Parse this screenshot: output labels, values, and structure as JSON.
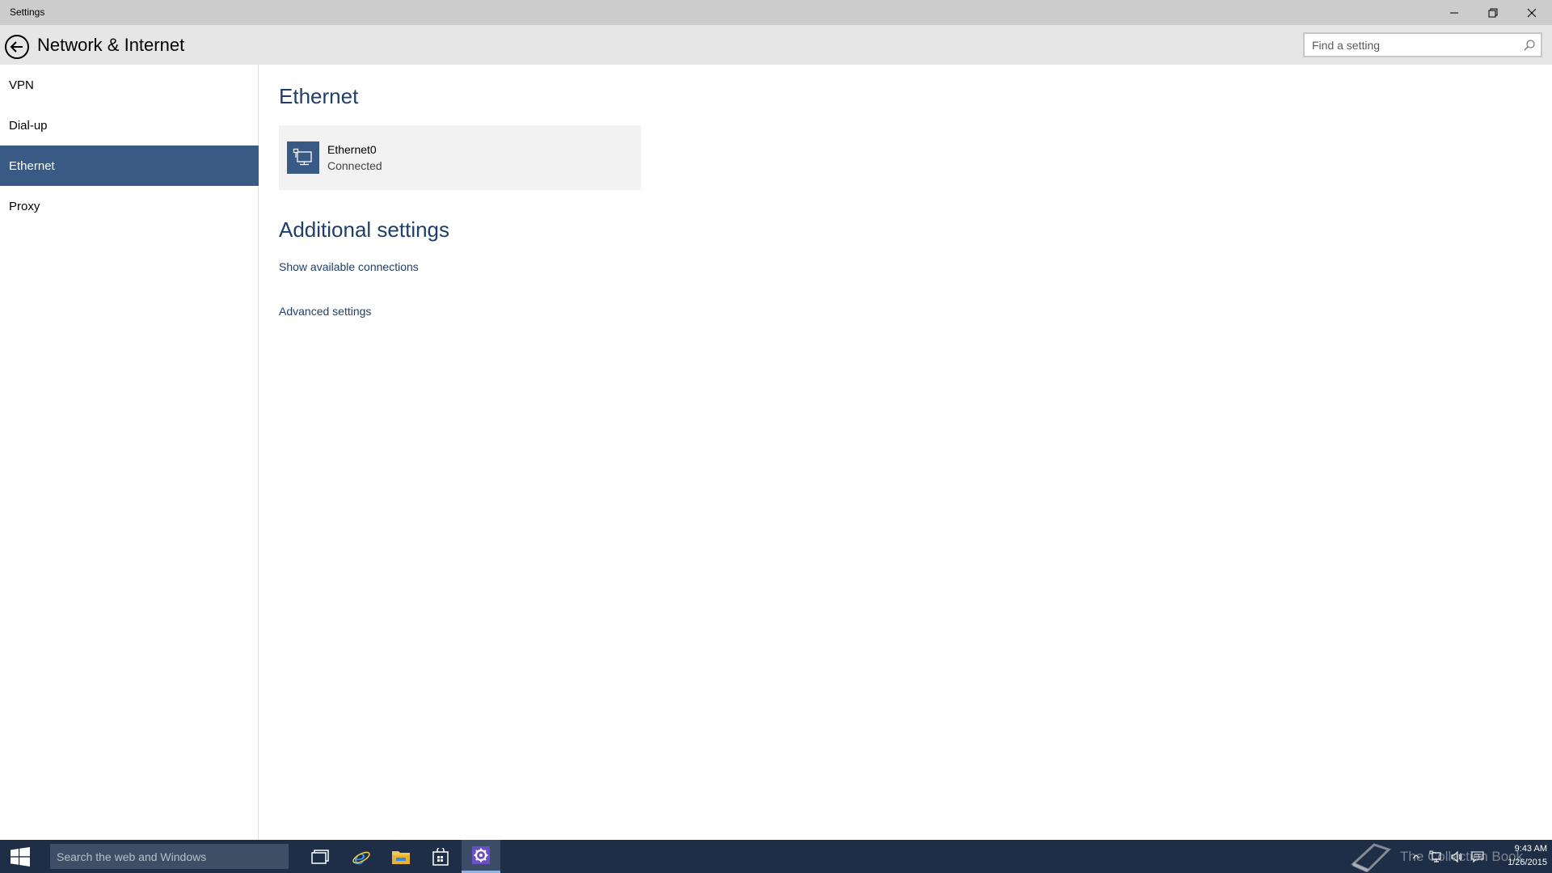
{
  "window": {
    "title": "Settings"
  },
  "header": {
    "title": "Network & Internet",
    "search_placeholder": "Find a setting"
  },
  "sidebar": {
    "items": [
      {
        "label": "VPN",
        "active": false
      },
      {
        "label": "Dial-up",
        "active": false
      },
      {
        "label": "Ethernet",
        "active": true
      },
      {
        "label": "Proxy",
        "active": false
      }
    ]
  },
  "main": {
    "section_title": "Ethernet",
    "connection": {
      "name": "Ethernet0",
      "status": "Connected",
      "icon": "ethernet-monitor-icon"
    },
    "additional_title": "Additional settings",
    "links": [
      {
        "label": "Show available connections"
      },
      {
        "label": "Advanced settings"
      }
    ]
  },
  "taskbar": {
    "search_placeholder": "Search the web and Windows",
    "apps": [
      "task-view-icon",
      "internet-explorer-icon",
      "file-explorer-icon",
      "store-icon",
      "settings-icon"
    ],
    "watermark": "The Collection Book",
    "time": "9:43 AM",
    "date": "1/26/2015"
  },
  "colors": {
    "accent": "#3a5a86",
    "link": "#1f3f6b",
    "taskbar": "#1d2e46",
    "header": "#e6e6e6",
    "titlebar": "#cccccc"
  }
}
